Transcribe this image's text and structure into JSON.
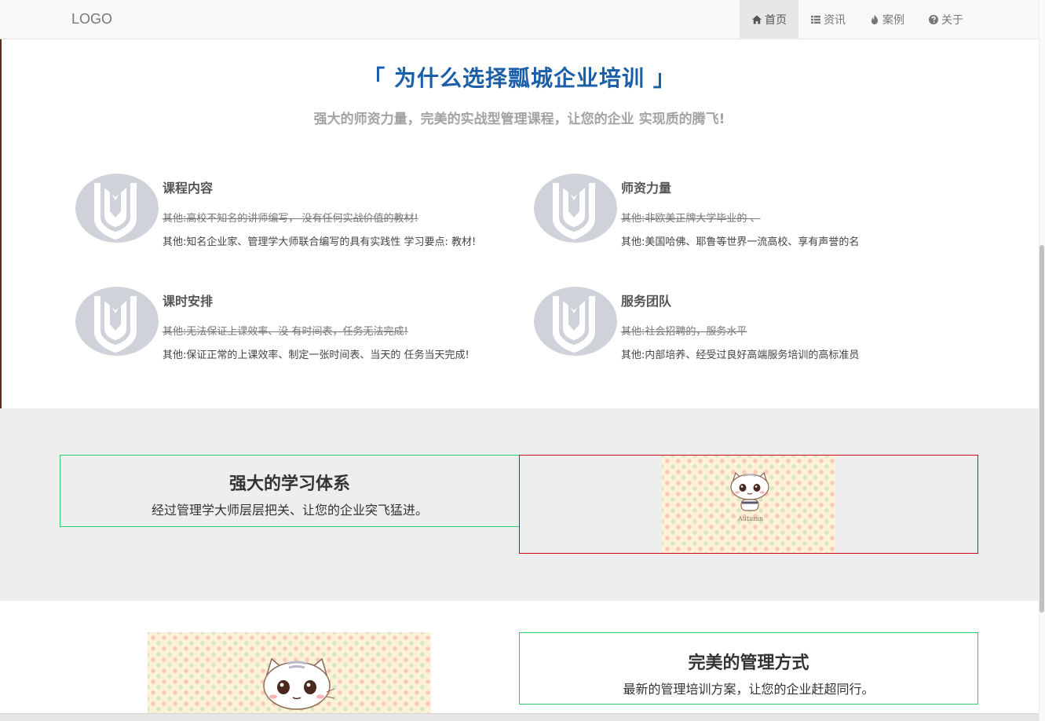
{
  "nav": {
    "logo": "LOGO",
    "items": [
      {
        "icon": "home-icon",
        "label": "首页",
        "active": true
      },
      {
        "icon": "list-icon",
        "label": "资讯",
        "active": false
      },
      {
        "icon": "fire-icon",
        "label": "案例",
        "active": false
      },
      {
        "icon": "question-circle-icon",
        "label": "关于",
        "active": false
      }
    ]
  },
  "intro": {
    "title": "「 为什么选择瓢城企业培训 」",
    "subtitle": "强大的师资力量，完美的实战型管理课程，让您的企业 实现质的腾飞!"
  },
  "features": [
    {
      "title": "课程内容",
      "old": "其他:高校不知名的讲师编写， 没有任何实战价值的教材!",
      "new": "其他:知名企业家、管理学大师联合编写的具有实践性 学习要点: 教材!"
    },
    {
      "title": "师资力量",
      "old": "其他:非欧美正牌大学毕业的 、",
      "new": "其他:美国哈佛、耶鲁等世界一流高校、享有声誉的名"
    },
    {
      "title": "课时安排",
      "old": "其他:无法保证上课效率、没 有时间表，任务无法完成!",
      "new": "其他:保证正常的上课效率、制定一张时间表、当天的 任务当天完成!"
    },
    {
      "title": "服务团队",
      "old": "其他:社会招聘的，服务水平",
      "new": "其他:内部培养、经受过良好高端服务培训的高标准员"
    }
  ],
  "section1": {
    "title": "强大的学习体系",
    "desc": "经过管理学大师层层把关、让您的企业突飞猛进。",
    "image_caption": "Autumn"
  },
  "section2": {
    "title": "完美的管理方式",
    "desc": "最新的管理培训方案，让您的企业赶超同行。"
  },
  "colors": {
    "title_blue": "#1a5fa8",
    "green_border": "#2ecc71",
    "red_border": "#d0021b",
    "band_gray": "#eeeeee"
  }
}
